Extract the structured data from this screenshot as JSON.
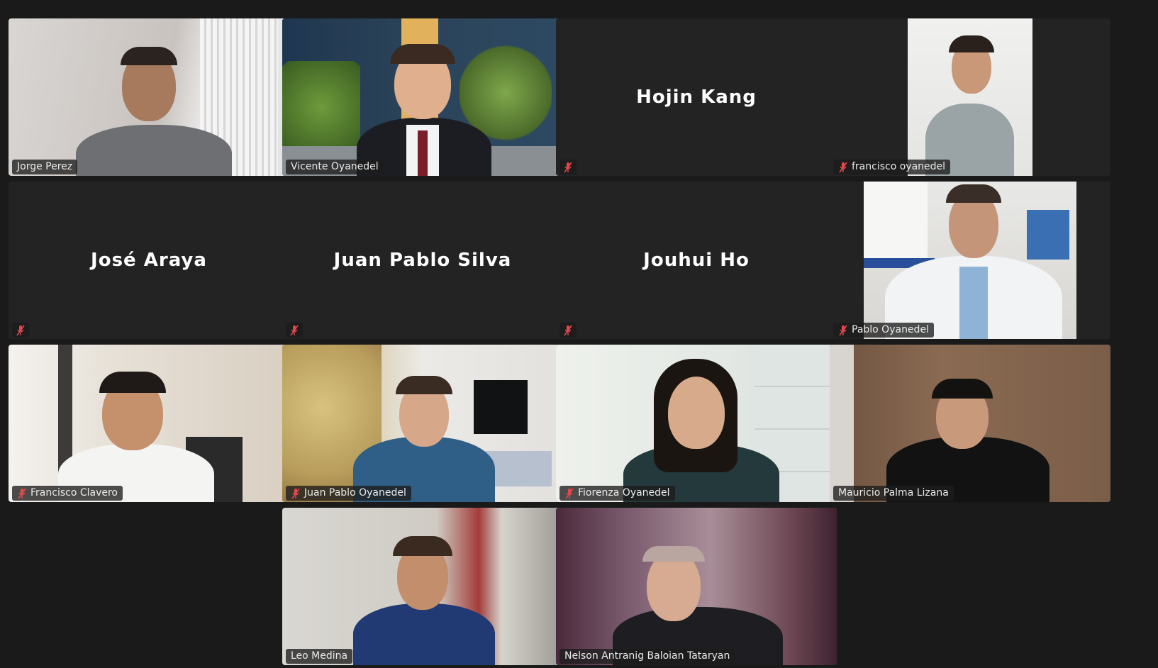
{
  "meeting": {
    "participants": [
      {
        "name": "Jorge Perez",
        "label": "Jorge Perez",
        "video": true,
        "muted": false
      },
      {
        "name": "Vicente Oyanedel",
        "label": "Vicente Oyanedel",
        "video": true,
        "muted": false
      },
      {
        "name": "Hojin Kang",
        "avatar_text": "Hojin Kang",
        "video": false,
        "muted": true
      },
      {
        "name": "francisco oyanedel",
        "label": "francisco oyanedel",
        "video": true,
        "muted": true
      },
      {
        "name": "José Araya",
        "avatar_text": "José Araya",
        "video": false,
        "muted": true
      },
      {
        "name": "Juan Pablo Silva",
        "avatar_text": "Juan Pablo Silva",
        "video": false,
        "muted": true
      },
      {
        "name": "Jouhui Ho",
        "avatar_text": "Jouhui Ho",
        "video": false,
        "muted": true
      },
      {
        "name": "Pablo Oyanedel",
        "label": "Pablo Oyanedel",
        "video": true,
        "muted": true
      },
      {
        "name": "Francisco Clavero",
        "label": "Francisco Clavero",
        "video": true,
        "muted": true
      },
      {
        "name": "Juan Pablo Oyanedel",
        "label": "Juan Pablo Oyanedel",
        "video": true,
        "muted": true
      },
      {
        "name": "Fiorenza Oyanedel",
        "label": "Fiorenza Oyanedel",
        "video": true,
        "muted": true
      },
      {
        "name": "Mauricio Palma Lizana",
        "label": "Mauricio Palma Lizana",
        "video": true,
        "muted": false
      },
      {
        "name": "Leo Medina",
        "label": "Leo Medina",
        "video": true,
        "muted": false
      },
      {
        "name": "Nelson Antranig Baloian Tataryan",
        "label": "Nelson Antranig Baloian Tataryan",
        "video": true,
        "muted": false,
        "active_speaker": true
      }
    ]
  },
  "colors": {
    "background": "#1a1a1a",
    "tile": "#232323",
    "active_speaker_border": "#2bd45e",
    "muted_icon": "#e5484d"
  },
  "icons": {
    "muted": "microphone-muted-icon"
  }
}
